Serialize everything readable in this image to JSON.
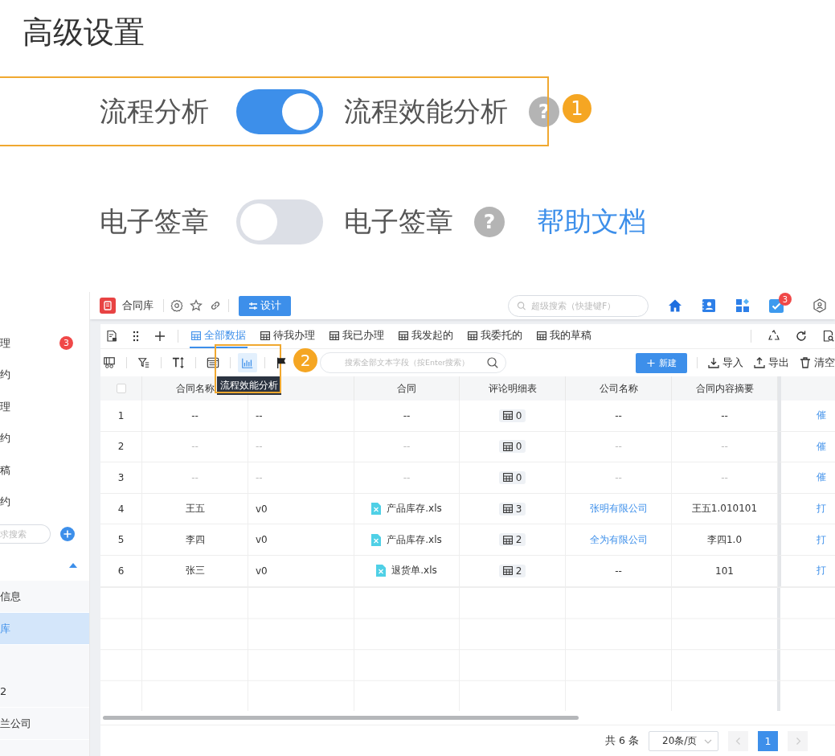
{
  "title": "高级设置",
  "settings": [
    {
      "label": "流程分析",
      "on": true,
      "description": "流程效能分析",
      "help_icon": "?",
      "callout": "1"
    },
    {
      "label": "电子签章",
      "on": false,
      "description": "电子签章",
      "help_icon": "?",
      "link": "帮助文档"
    }
  ],
  "app": {
    "header": {
      "app_name": "合同库",
      "design_button": "设计",
      "search_placeholder": "超级搜索（快捷键F）",
      "task_badge": "3"
    },
    "sidebar": {
      "items": [
        {
          "label": "理",
          "badge": "3",
          "selected": false
        },
        {
          "label": "约",
          "selected": false
        },
        {
          "label": "理",
          "selected": false
        },
        {
          "label": "约",
          "selected": false
        },
        {
          "label": "稿",
          "selected": false
        },
        {
          "label": "约",
          "selected": false
        }
      ],
      "search_placeholder": "求搜索",
      "groups": [
        {
          "label": "信息",
          "selected": false
        },
        {
          "label": "库",
          "selected": true
        },
        {
          "label": "2",
          "selected": false
        },
        {
          "label": "兰公司",
          "selected": false
        }
      ]
    },
    "views": [
      {
        "label": "全部数据",
        "selected": true
      },
      {
        "label": "待我办理",
        "selected": false
      },
      {
        "label": "我已办理",
        "selected": false
      },
      {
        "label": "我发起的",
        "selected": false
      },
      {
        "label": "我委托的",
        "selected": false
      },
      {
        "label": "我的草稿",
        "selected": false
      }
    ],
    "toolbar": {
      "tools": [
        {
          "kind": "layout"
        },
        {
          "kind": "filter"
        },
        {
          "kind": "text-size"
        },
        {
          "kind": "window"
        },
        {
          "kind": "chart",
          "highlighted": true,
          "tooltip": "流程效能分析",
          "callout": "2"
        },
        {
          "kind": "flag"
        }
      ],
      "search_placeholder": "搜索全部文本字段（按Enter搜索）",
      "new_button": "新建",
      "import_button": "导入",
      "export_button": "导出",
      "clear_button": "清空"
    },
    "table": {
      "columns": [
        {
          "kind": "check"
        },
        {
          "kind": "text",
          "label": "合同名称"
        },
        {
          "kind": "text"
        },
        {
          "kind": "text",
          "label": "合同"
        },
        {
          "kind": "text",
          "label": "评论明细表"
        },
        {
          "kind": "text",
          "label": "公司名称"
        },
        {
          "kind": "text",
          "label": "合同内容摘要"
        },
        {
          "kind": "action"
        }
      ],
      "rows": [
        {
          "index": "1",
          "name": "--",
          "version": "--",
          "file": "--",
          "comments": "0",
          "company": "--",
          "summary": "--",
          "action": "催",
          "dimmed": false
        },
        {
          "index": "2",
          "name": "--",
          "version": "--",
          "file": "--",
          "comments": "0",
          "company": "--",
          "summary": "--",
          "action": "催",
          "dimmed": true
        },
        {
          "index": "3",
          "name": "--",
          "version": "--",
          "file": "--",
          "comments": "0",
          "company": "--",
          "summary": "--",
          "action": "催",
          "dimmed": true
        },
        {
          "index": "4",
          "name": "王五",
          "version": "v0",
          "file": "产品库存.xls",
          "file_attached": true,
          "comments": "3",
          "company": "张明有限公司",
          "company_link": true,
          "summary": "王五1.010101",
          "action": "打",
          "dimmed": false
        },
        {
          "index": "5",
          "name": "李四",
          "version": "v0",
          "file": "产品库存.xls",
          "file_attached": true,
          "comments": "2",
          "company": "全为有限公司",
          "company_link": true,
          "summary": "李四1.0",
          "action": "打",
          "dimmed": false
        },
        {
          "index": "6",
          "name": "张三",
          "version": "v0",
          "file": "退货单.xls",
          "file_attached": true,
          "comments": "2",
          "company": "--",
          "summary": "101",
          "action": "打",
          "dimmed": false
        }
      ],
      "select_all_checked": false
    },
    "pagination": {
      "total": "共 6 条",
      "page_size": "20条/页",
      "pages": [
        {
          "label": "1",
          "selected": true
        }
      ]
    }
  }
}
